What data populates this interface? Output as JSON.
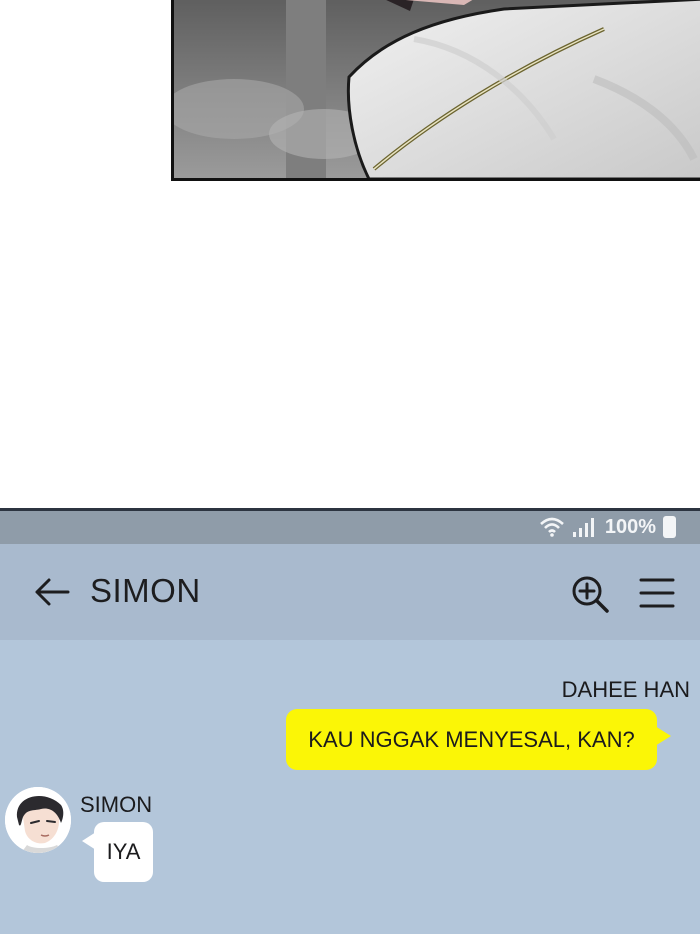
{
  "status_bar": {
    "battery_text": "100%",
    "wifi_icon": "wifi-icon",
    "signal_icon": "signal-bars-icon",
    "battery_icon": "battery-icon"
  },
  "header": {
    "title": "SIMON",
    "back_icon": "arrow-left-icon",
    "zoom_icon": "zoom-in-icon",
    "menu_icon": "hamburger-menu-icon"
  },
  "messages": [
    {
      "sender": "DAHEE HAN",
      "text": "KAU NGGAK MENYESAL, KAN?",
      "side": "right",
      "bubble_color": "#fbf606"
    },
    {
      "sender": "SIMON",
      "text": "IYA",
      "side": "left",
      "bubble_color": "#ffffff"
    }
  ],
  "colors": {
    "status_bar_bg": "#8f9ca9",
    "title_bar_bg": "#a9bace",
    "chat_bg": "#b3c6da",
    "outgoing_bubble": "#fbf606",
    "incoming_bubble": "#ffffff"
  }
}
